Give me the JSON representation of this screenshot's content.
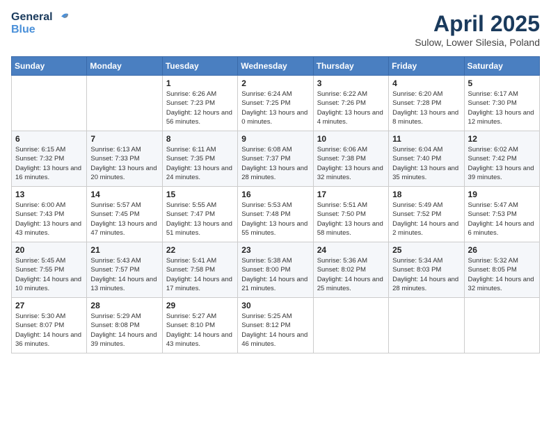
{
  "header": {
    "logo_line1": "General",
    "logo_line2": "Blue",
    "month": "April 2025",
    "location": "Sulow, Lower Silesia, Poland"
  },
  "weekdays": [
    "Sunday",
    "Monday",
    "Tuesday",
    "Wednesday",
    "Thursday",
    "Friday",
    "Saturday"
  ],
  "weeks": [
    [
      {
        "day": "",
        "info": ""
      },
      {
        "day": "",
        "info": ""
      },
      {
        "day": "1",
        "info": "Sunrise: 6:26 AM\nSunset: 7:23 PM\nDaylight: 12 hours\nand 56 minutes."
      },
      {
        "day": "2",
        "info": "Sunrise: 6:24 AM\nSunset: 7:25 PM\nDaylight: 13 hours\nand 0 minutes."
      },
      {
        "day": "3",
        "info": "Sunrise: 6:22 AM\nSunset: 7:26 PM\nDaylight: 13 hours\nand 4 minutes."
      },
      {
        "day": "4",
        "info": "Sunrise: 6:20 AM\nSunset: 7:28 PM\nDaylight: 13 hours\nand 8 minutes."
      },
      {
        "day": "5",
        "info": "Sunrise: 6:17 AM\nSunset: 7:30 PM\nDaylight: 13 hours\nand 12 minutes."
      }
    ],
    [
      {
        "day": "6",
        "info": "Sunrise: 6:15 AM\nSunset: 7:32 PM\nDaylight: 13 hours\nand 16 minutes."
      },
      {
        "day": "7",
        "info": "Sunrise: 6:13 AM\nSunset: 7:33 PM\nDaylight: 13 hours\nand 20 minutes."
      },
      {
        "day": "8",
        "info": "Sunrise: 6:11 AM\nSunset: 7:35 PM\nDaylight: 13 hours\nand 24 minutes."
      },
      {
        "day": "9",
        "info": "Sunrise: 6:08 AM\nSunset: 7:37 PM\nDaylight: 13 hours\nand 28 minutes."
      },
      {
        "day": "10",
        "info": "Sunrise: 6:06 AM\nSunset: 7:38 PM\nDaylight: 13 hours\nand 32 minutes."
      },
      {
        "day": "11",
        "info": "Sunrise: 6:04 AM\nSunset: 7:40 PM\nDaylight: 13 hours\nand 35 minutes."
      },
      {
        "day": "12",
        "info": "Sunrise: 6:02 AM\nSunset: 7:42 PM\nDaylight: 13 hours\nand 39 minutes."
      }
    ],
    [
      {
        "day": "13",
        "info": "Sunrise: 6:00 AM\nSunset: 7:43 PM\nDaylight: 13 hours\nand 43 minutes."
      },
      {
        "day": "14",
        "info": "Sunrise: 5:57 AM\nSunset: 7:45 PM\nDaylight: 13 hours\nand 47 minutes."
      },
      {
        "day": "15",
        "info": "Sunrise: 5:55 AM\nSunset: 7:47 PM\nDaylight: 13 hours\nand 51 minutes."
      },
      {
        "day": "16",
        "info": "Sunrise: 5:53 AM\nSunset: 7:48 PM\nDaylight: 13 hours\nand 55 minutes."
      },
      {
        "day": "17",
        "info": "Sunrise: 5:51 AM\nSunset: 7:50 PM\nDaylight: 13 hours\nand 58 minutes."
      },
      {
        "day": "18",
        "info": "Sunrise: 5:49 AM\nSunset: 7:52 PM\nDaylight: 14 hours\nand 2 minutes."
      },
      {
        "day": "19",
        "info": "Sunrise: 5:47 AM\nSunset: 7:53 PM\nDaylight: 14 hours\nand 6 minutes."
      }
    ],
    [
      {
        "day": "20",
        "info": "Sunrise: 5:45 AM\nSunset: 7:55 PM\nDaylight: 14 hours\nand 10 minutes."
      },
      {
        "day": "21",
        "info": "Sunrise: 5:43 AM\nSunset: 7:57 PM\nDaylight: 14 hours\nand 13 minutes."
      },
      {
        "day": "22",
        "info": "Sunrise: 5:41 AM\nSunset: 7:58 PM\nDaylight: 14 hours\nand 17 minutes."
      },
      {
        "day": "23",
        "info": "Sunrise: 5:38 AM\nSunset: 8:00 PM\nDaylight: 14 hours\nand 21 minutes."
      },
      {
        "day": "24",
        "info": "Sunrise: 5:36 AM\nSunset: 8:02 PM\nDaylight: 14 hours\nand 25 minutes."
      },
      {
        "day": "25",
        "info": "Sunrise: 5:34 AM\nSunset: 8:03 PM\nDaylight: 14 hours\nand 28 minutes."
      },
      {
        "day": "26",
        "info": "Sunrise: 5:32 AM\nSunset: 8:05 PM\nDaylight: 14 hours\nand 32 minutes."
      }
    ],
    [
      {
        "day": "27",
        "info": "Sunrise: 5:30 AM\nSunset: 8:07 PM\nDaylight: 14 hours\nand 36 minutes."
      },
      {
        "day": "28",
        "info": "Sunrise: 5:29 AM\nSunset: 8:08 PM\nDaylight: 14 hours\nand 39 minutes."
      },
      {
        "day": "29",
        "info": "Sunrise: 5:27 AM\nSunset: 8:10 PM\nDaylight: 14 hours\nand 43 minutes."
      },
      {
        "day": "30",
        "info": "Sunrise: 5:25 AM\nSunset: 8:12 PM\nDaylight: 14 hours\nand 46 minutes."
      },
      {
        "day": "",
        "info": ""
      },
      {
        "day": "",
        "info": ""
      },
      {
        "day": "",
        "info": ""
      }
    ]
  ]
}
